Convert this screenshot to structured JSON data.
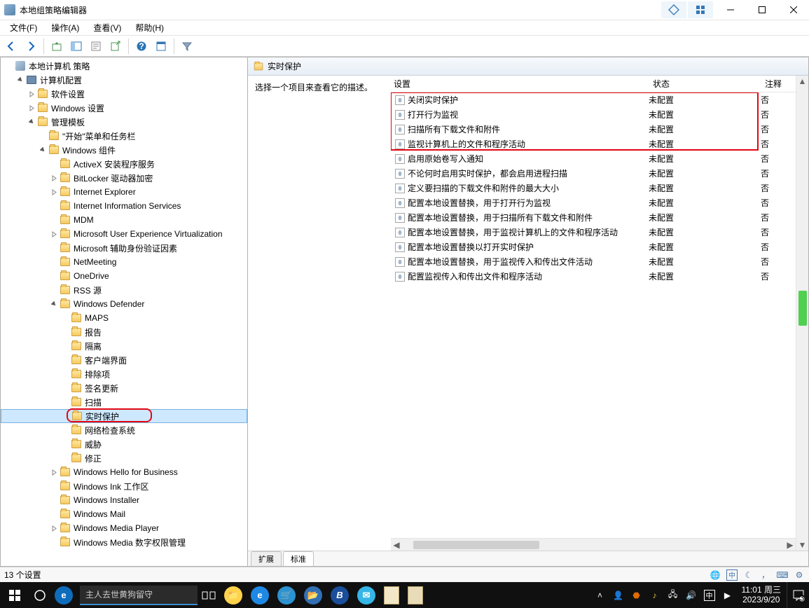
{
  "window": {
    "title": "本地组策略编辑器",
    "status": "13 个设置"
  },
  "menu": {
    "file": "文件(F)",
    "action": "操作(A)",
    "view": "查看(V)",
    "help": "帮助(H)"
  },
  "tree": {
    "root": "本地计算机 策略",
    "computer_config": "计算机配置",
    "software_settings": "软件设置",
    "windows_settings": "Windows 设置",
    "admin_templates": "管理模板",
    "start_menu_taskbar": "\"开始\"菜单和任务栏",
    "windows_components": "Windows 组件",
    "activex": "ActiveX 安装程序服务",
    "bitlocker": "BitLocker 驱动器加密",
    "ie": "Internet Explorer",
    "iis": "Internet Information Services",
    "mdm": "MDM",
    "uev": "Microsoft User Experience Virtualization",
    "secondary_auth": "Microsoft 辅助身份验证因素",
    "netmeeting": "NetMeeting",
    "onedrive": "OneDrive",
    "rss": "RSS 源",
    "defender": "Windows Defender",
    "maps": "MAPS",
    "report": "报告",
    "quarantine": "隔离",
    "client_ui": "客户端界面",
    "exclusions": "排除项",
    "sig_updates": "签名更新",
    "scan": "扫描",
    "realtime": "实时保护",
    "network_inspection": "网络检查系统",
    "threats": "威胁",
    "remediation": "修正",
    "hello": "Windows Hello for Business",
    "ink": "Windows Ink 工作区",
    "installer": "Windows Installer",
    "mail": "Windows Mail",
    "mediaplayer": "Windows Media Player",
    "drm": "Windows Media 数字权限管理"
  },
  "right": {
    "crumb": "实时保护",
    "hint": "选择一个项目来查看它的描述。",
    "col_setting": "设置",
    "col_state": "状态",
    "col_note": "注释",
    "rows": [
      {
        "label": "关闭实时保护",
        "state": "未配置",
        "note": "否"
      },
      {
        "label": "打开行为监视",
        "state": "未配置",
        "note": "否"
      },
      {
        "label": "扫描所有下载文件和附件",
        "state": "未配置",
        "note": "否"
      },
      {
        "label": "监视计算机上的文件和程序活动",
        "state": "未配置",
        "note": "否"
      },
      {
        "label": "启用原始卷写入通知",
        "state": "未配置",
        "note": "否"
      },
      {
        "label": "不论何时启用实时保护，都会启用进程扫描",
        "state": "未配置",
        "note": "否"
      },
      {
        "label": "定义要扫描的下载文件和附件的最大大小",
        "state": "未配置",
        "note": "否"
      },
      {
        "label": "配置本地设置替换，用于打开行为监视",
        "state": "未配置",
        "note": "否"
      },
      {
        "label": "配置本地设置替换，用于扫描所有下载文件和附件",
        "state": "未配置",
        "note": "否"
      },
      {
        "label": "配置本地设置替换，用于监视计算机上的文件和程序活动",
        "state": "未配置",
        "note": "否"
      },
      {
        "label": "配置本地设置替换以打开实时保护",
        "state": "未配置",
        "note": "否"
      },
      {
        "label": "配置本地设置替换，用于监视传入和传出文件活动",
        "state": "未配置",
        "note": "否"
      },
      {
        "label": "配置监视传入和传出文件和程序活动",
        "state": "未配置",
        "note": "否"
      }
    ],
    "tab_extended": "扩展",
    "tab_standard": "标准"
  },
  "taskbar": {
    "search_placeholder": "主人去世黄狗留守",
    "time": "11:01 周三",
    "date": "2023/9/20"
  }
}
